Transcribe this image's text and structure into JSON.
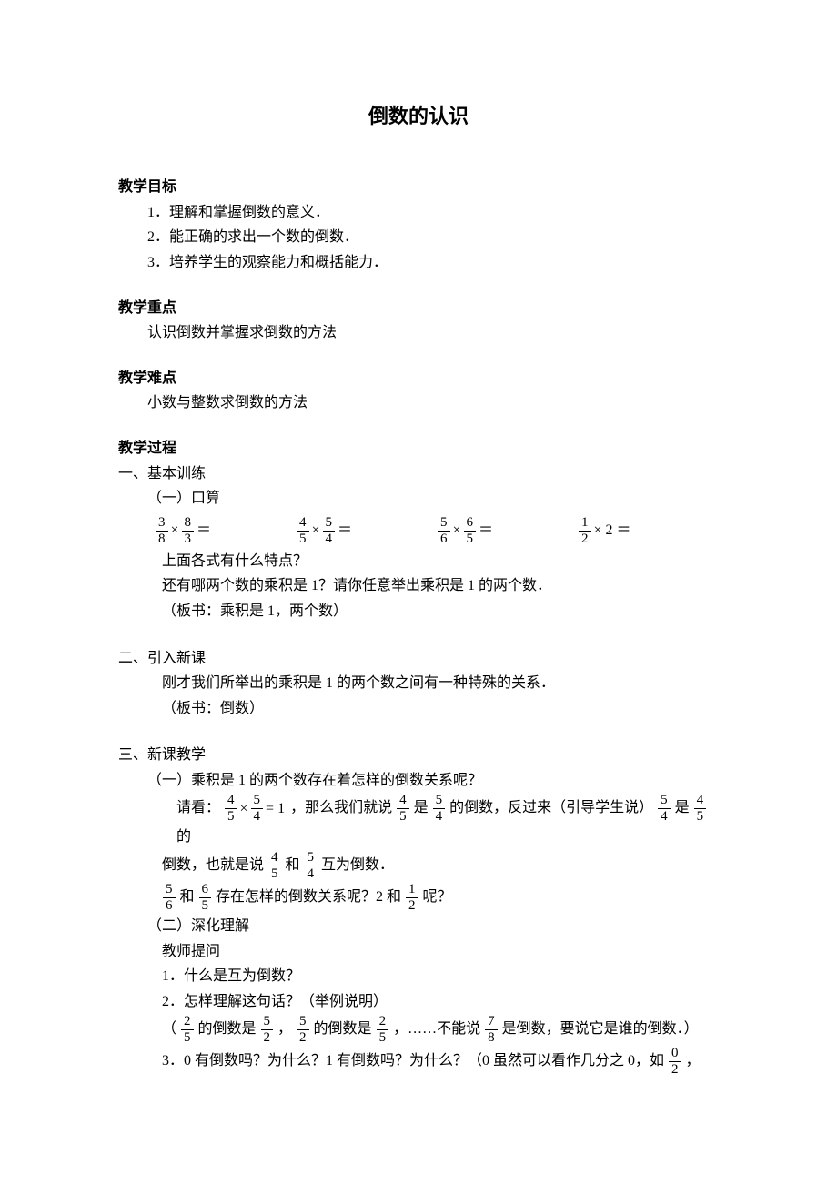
{
  "title": "倒数的认识",
  "objectives": {
    "heading": "教学目标",
    "items": [
      "1．理解和掌握倒数的意义．",
      "2．能正确的求出一个数的倒数．",
      "3．培养学生的观察能力和概括能力．"
    ]
  },
  "keypoint": {
    "heading": "教学重点",
    "text": "认识倒数并掌握求倒数的方法"
  },
  "difficulty": {
    "heading": "教学难点",
    "text": "小数与整数求倒数的方法"
  },
  "process": {
    "heading": "教学过程",
    "s1": {
      "title": "一、基本训练",
      "sub1": "（一）口算",
      "exprs": {
        "a": {
          "f1n": "3",
          "f1d": "8",
          "f2n": "8",
          "f2d": "3",
          "op": "×",
          "eq": "＝"
        },
        "b": {
          "f1n": "4",
          "f1d": "5",
          "f2n": "5",
          "f2d": "4",
          "op": "×",
          "eq": "＝"
        },
        "c": {
          "f1n": "5",
          "f1d": "6",
          "f2n": "6",
          "f2d": "5",
          "op": "×",
          "eq": "＝"
        },
        "d": {
          "f1n": "1",
          "f1d": "2",
          "b": "2",
          "op": "×",
          "eq": "＝"
        }
      },
      "q1": "上面各式有什么特点？",
      "q2": "还有哪两个数的乘积是 1？请你任意举出乘积是 1 的两个数．",
      "note": "（板书：乘积是 1，两个数）"
    },
    "s2": {
      "title": "二、引入新课",
      "p1": "刚才我们所举出的乘积是 1 的两个数之间有一种特殊的关系．",
      "note": "（板书：倒数）"
    },
    "s3": {
      "title": "三、新课教学",
      "a": {
        "title": "（一）乘积是 1 的两个数存在着怎样的倒数关系呢？",
        "line1_pre": "请看：",
        "eq": {
          "f1n": "4",
          "f1d": "5",
          "f2n": "5",
          "f2d": "4",
          "res": "= 1"
        },
        "line1_mid1": "，那么我们就说",
        "f45": {
          "n": "4",
          "d": "5"
        },
        "line1_mid2": "是",
        "f54": {
          "n": "5",
          "d": "4"
        },
        "line1_mid3": "的倒数，反过来（引导学生说）",
        "line1_end": "是",
        "line1_tail": "的",
        "line2_left": "倒数，也就是说",
        "line2_mid": "和",
        "line2_end": "互为倒数．",
        "f56": {
          "n": "5",
          "d": "6"
        },
        "f65": {
          "n": "6",
          "d": "5"
        },
        "line3_a": "和",
        "line3_b": "存在怎样的倒数关系呢？2 和",
        "f12": {
          "n": "1",
          "d": "2"
        },
        "line3_c": "呢？"
      },
      "b": {
        "title": "（二）深化理解",
        "teacher": "教师提问",
        "q1": "1．什么是互为倒数？",
        "q2": "2．怎样理解这句话？（举例说明）",
        "ex_open": "（",
        "f25": {
          "n": "2",
          "d": "5"
        },
        "ex_a": "的倒数是",
        "f52": {
          "n": "5",
          "d": "2"
        },
        "ex_c1": "，",
        "ex_b": "的倒数是",
        "ex_c2": "，……不能说",
        "f78": {
          "n": "7",
          "d": "8"
        },
        "ex_end": "是倒数，要说它是谁的倒数．）",
        "q3_a": "3．0 有倒数吗？为什么？1 有倒数吗？为什么？（0 虽然可以看作几分之 0，如",
        "f02": {
          "n": "0",
          "d": "2"
        },
        "q3_b": "，"
      }
    }
  }
}
